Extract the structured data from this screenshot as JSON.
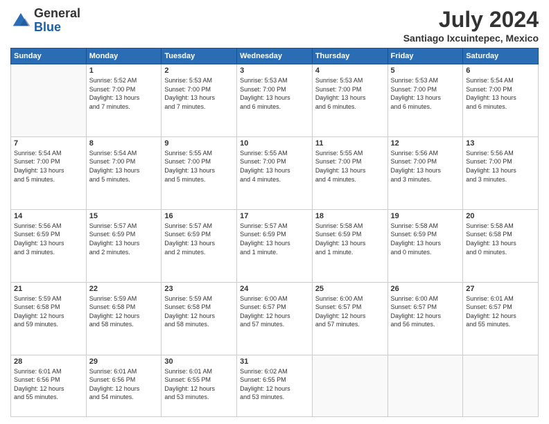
{
  "logo": {
    "general": "General",
    "blue": "Blue"
  },
  "header": {
    "month": "July 2024",
    "location": "Santiago Ixcuintepec, Mexico"
  },
  "columns": [
    "Sunday",
    "Monday",
    "Tuesday",
    "Wednesday",
    "Thursday",
    "Friday",
    "Saturday"
  ],
  "weeks": [
    [
      {
        "day": "",
        "detail": ""
      },
      {
        "day": "1",
        "detail": "Sunrise: 5:52 AM\nSunset: 7:00 PM\nDaylight: 13 hours\nand 7 minutes."
      },
      {
        "day": "2",
        "detail": "Sunrise: 5:53 AM\nSunset: 7:00 PM\nDaylight: 13 hours\nand 7 minutes."
      },
      {
        "day": "3",
        "detail": "Sunrise: 5:53 AM\nSunset: 7:00 PM\nDaylight: 13 hours\nand 6 minutes."
      },
      {
        "day": "4",
        "detail": "Sunrise: 5:53 AM\nSunset: 7:00 PM\nDaylight: 13 hours\nand 6 minutes."
      },
      {
        "day": "5",
        "detail": "Sunrise: 5:53 AM\nSunset: 7:00 PM\nDaylight: 13 hours\nand 6 minutes."
      },
      {
        "day": "6",
        "detail": "Sunrise: 5:54 AM\nSunset: 7:00 PM\nDaylight: 13 hours\nand 6 minutes."
      }
    ],
    [
      {
        "day": "7",
        "detail": "Sunrise: 5:54 AM\nSunset: 7:00 PM\nDaylight: 13 hours\nand 5 minutes."
      },
      {
        "day": "8",
        "detail": "Sunrise: 5:54 AM\nSunset: 7:00 PM\nDaylight: 13 hours\nand 5 minutes."
      },
      {
        "day": "9",
        "detail": "Sunrise: 5:55 AM\nSunset: 7:00 PM\nDaylight: 13 hours\nand 5 minutes."
      },
      {
        "day": "10",
        "detail": "Sunrise: 5:55 AM\nSunset: 7:00 PM\nDaylight: 13 hours\nand 4 minutes."
      },
      {
        "day": "11",
        "detail": "Sunrise: 5:55 AM\nSunset: 7:00 PM\nDaylight: 13 hours\nand 4 minutes."
      },
      {
        "day": "12",
        "detail": "Sunrise: 5:56 AM\nSunset: 7:00 PM\nDaylight: 13 hours\nand 3 minutes."
      },
      {
        "day": "13",
        "detail": "Sunrise: 5:56 AM\nSunset: 7:00 PM\nDaylight: 13 hours\nand 3 minutes."
      }
    ],
    [
      {
        "day": "14",
        "detail": "Sunrise: 5:56 AM\nSunset: 6:59 PM\nDaylight: 13 hours\nand 3 minutes."
      },
      {
        "day": "15",
        "detail": "Sunrise: 5:57 AM\nSunset: 6:59 PM\nDaylight: 13 hours\nand 2 minutes."
      },
      {
        "day": "16",
        "detail": "Sunrise: 5:57 AM\nSunset: 6:59 PM\nDaylight: 13 hours\nand 2 minutes."
      },
      {
        "day": "17",
        "detail": "Sunrise: 5:57 AM\nSunset: 6:59 PM\nDaylight: 13 hours\nand 1 minute."
      },
      {
        "day": "18",
        "detail": "Sunrise: 5:58 AM\nSunset: 6:59 PM\nDaylight: 13 hours\nand 1 minute."
      },
      {
        "day": "19",
        "detail": "Sunrise: 5:58 AM\nSunset: 6:59 PM\nDaylight: 13 hours\nand 0 minutes."
      },
      {
        "day": "20",
        "detail": "Sunrise: 5:58 AM\nSunset: 6:58 PM\nDaylight: 13 hours\nand 0 minutes."
      }
    ],
    [
      {
        "day": "21",
        "detail": "Sunrise: 5:59 AM\nSunset: 6:58 PM\nDaylight: 12 hours\nand 59 minutes."
      },
      {
        "day": "22",
        "detail": "Sunrise: 5:59 AM\nSunset: 6:58 PM\nDaylight: 12 hours\nand 58 minutes."
      },
      {
        "day": "23",
        "detail": "Sunrise: 5:59 AM\nSunset: 6:58 PM\nDaylight: 12 hours\nand 58 minutes."
      },
      {
        "day": "24",
        "detail": "Sunrise: 6:00 AM\nSunset: 6:57 PM\nDaylight: 12 hours\nand 57 minutes."
      },
      {
        "day": "25",
        "detail": "Sunrise: 6:00 AM\nSunset: 6:57 PM\nDaylight: 12 hours\nand 57 minutes."
      },
      {
        "day": "26",
        "detail": "Sunrise: 6:00 AM\nSunset: 6:57 PM\nDaylight: 12 hours\nand 56 minutes."
      },
      {
        "day": "27",
        "detail": "Sunrise: 6:01 AM\nSunset: 6:57 PM\nDaylight: 12 hours\nand 55 minutes."
      }
    ],
    [
      {
        "day": "28",
        "detail": "Sunrise: 6:01 AM\nSunset: 6:56 PM\nDaylight: 12 hours\nand 55 minutes."
      },
      {
        "day": "29",
        "detail": "Sunrise: 6:01 AM\nSunset: 6:56 PM\nDaylight: 12 hours\nand 54 minutes."
      },
      {
        "day": "30",
        "detail": "Sunrise: 6:01 AM\nSunset: 6:55 PM\nDaylight: 12 hours\nand 53 minutes."
      },
      {
        "day": "31",
        "detail": "Sunrise: 6:02 AM\nSunset: 6:55 PM\nDaylight: 12 hours\nand 53 minutes."
      },
      {
        "day": "",
        "detail": ""
      },
      {
        "day": "",
        "detail": ""
      },
      {
        "day": "",
        "detail": ""
      }
    ]
  ]
}
